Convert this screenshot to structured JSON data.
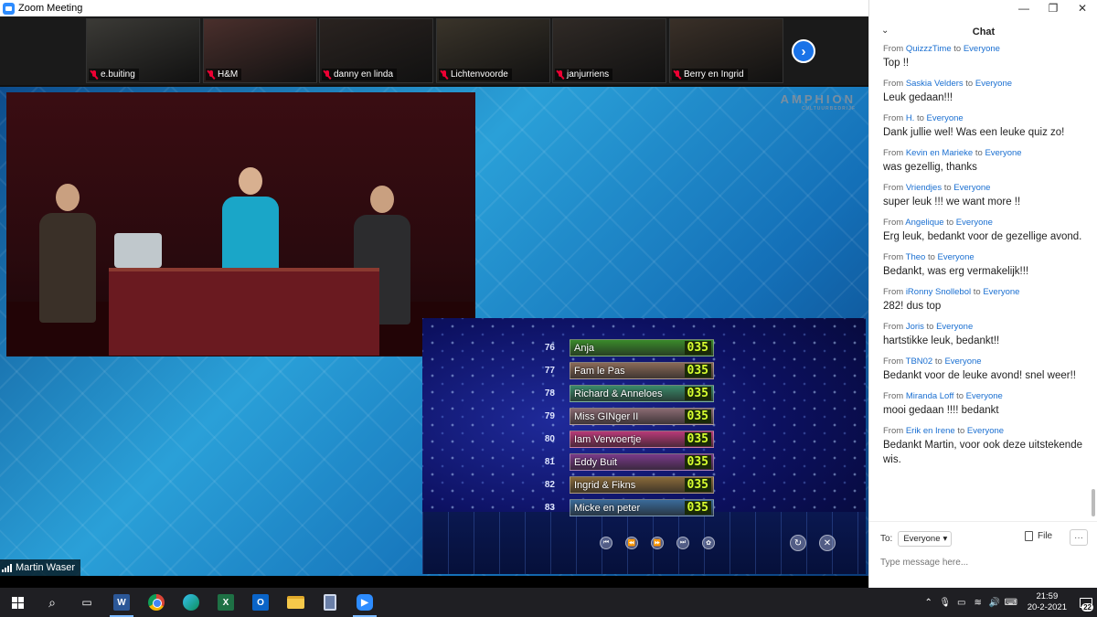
{
  "window": {
    "title": "Zoom Meeting"
  },
  "participants": [
    {
      "name": "e.buiting",
      "muted": true,
      "bg": "#3b3a36"
    },
    {
      "name": "H&M",
      "muted": true,
      "bg": "#4a2f2c"
    },
    {
      "name": "danny en linda",
      "muted": true,
      "bg": "#2a2320"
    },
    {
      "name": "Lichtenvoorde",
      "muted": true,
      "bg": "#3a342a"
    },
    {
      "name": "janjurriens",
      "muted": true,
      "bg": "#302a26"
    },
    {
      "name": "Berry en Ingrid",
      "muted": true,
      "bg": "#3a3028"
    }
  ],
  "share": {
    "brand": "AMPHION",
    "brand_sub": "CULTUURBEDRIJF",
    "speaker": "Martin Waser",
    "scoreboard": [
      {
        "rank": "76",
        "team": "Anja",
        "points": "035",
        "color": "#3a8a2a"
      },
      {
        "rank": "77",
        "team": "Fam le Pas",
        "points": "035",
        "color": "#8a6a58"
      },
      {
        "rank": "78",
        "team": "Richard & Anneloes",
        "points": "035",
        "color": "#3a8a6a"
      },
      {
        "rank": "79",
        "team": "Miss GINger II",
        "points": "035",
        "color": "#8a6a72"
      },
      {
        "rank": "80",
        "team": "Iam Verwoertje",
        "points": "035",
        "color": "#b83a78"
      },
      {
        "rank": "81",
        "team": "Eddy Buit",
        "points": "035",
        "color": "#7a3a8a"
      },
      {
        "rank": "82",
        "team": "Ingrid & Fikns",
        "points": "035",
        "color": "#8a6a3a"
      },
      {
        "rank": "83",
        "team": "Micke en peter",
        "points": "035",
        "color": "#3a6a9a"
      }
    ]
  },
  "chat": {
    "title": "Chat",
    "messages": [
      {
        "from": "QuizzzTime",
        "to": "Everyone",
        "text": "Top !!"
      },
      {
        "from": "Saskia Velders",
        "to": "Everyone",
        "text": "Leuk gedaan!!!"
      },
      {
        "from": "H.",
        "to": "Everyone",
        "text": "Dank jullie wel! Was een leuke quiz zo!"
      },
      {
        "from": "Kevin en Marieke",
        "to": "Everyone",
        "text": "was gezellig, thanks"
      },
      {
        "from": "Vriendjes",
        "to": "Everyone",
        "text": "super leuk !!! we want more !!"
      },
      {
        "from": "Angelique",
        "to": "Everyone",
        "text": "Erg leuk, bedankt voor de gezellige avond."
      },
      {
        "from": "Theo",
        "to": "Everyone",
        "text": "Bedankt, was erg vermakelijk!!!"
      },
      {
        "from": "iRonny Snollebol",
        "to": "Everyone",
        "text": "282!   dus top"
      },
      {
        "from": "Joris",
        "to": "Everyone",
        "text": "hartstikke leuk, bedankt!!"
      },
      {
        "from": "TBN02",
        "to": "Everyone",
        "text": "Bedankt voor de leuke avond! snel weer!!"
      },
      {
        "from": "Miranda Loff",
        "to": "Everyone",
        "text": "mooi gedaan !!!!  bedankt"
      },
      {
        "from": "Erik en Irene",
        "to": "Everyone",
        "text": "Bedankt Martin, voor ook deze uitstekende wis."
      }
    ],
    "from_word": "From",
    "to_word": "to",
    "to_label": "To:",
    "recipient": "Everyone",
    "file_label": "File",
    "input_placeholder": "Type message here..."
  },
  "taskbar": {
    "time": "21:59",
    "date": "20-2-2021",
    "notifications": "22",
    "apps": [
      "word",
      "chrome",
      "edge",
      "excel",
      "outlook",
      "file-explorer",
      "calculator",
      "zoom"
    ]
  }
}
